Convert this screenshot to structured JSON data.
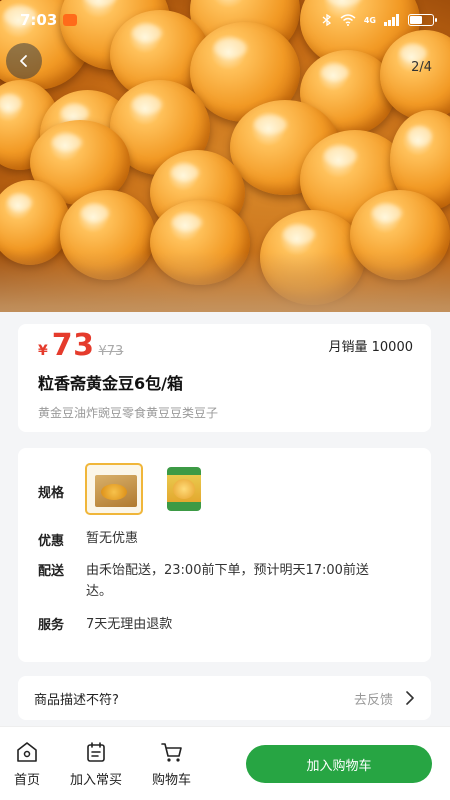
{
  "status_bar": {
    "time": "7:03",
    "network": "4G"
  },
  "gallery": {
    "pager": "2/4"
  },
  "price": {
    "currency": "¥",
    "current": "73",
    "original": "¥73"
  },
  "sales": "月销量 10000",
  "product": {
    "title": "粒香斋黄金豆6包/箱",
    "subtitle": "黄金豆油炸豌豆零食黄豆豆类豆子"
  },
  "spec": {
    "label": "规格"
  },
  "discount": {
    "label": "优惠",
    "value": "暂无优惠"
  },
  "delivery": {
    "label": "配送",
    "line1": "由禾饴配送，23:00前下单，预计明天17:00前送",
    "line2": "达。"
  },
  "service": {
    "label": "服务",
    "value": "7天无理由退款"
  },
  "feedback": {
    "label": "商品描述不符?",
    "action": "去反馈"
  },
  "bottom_bar": {
    "home": "首页",
    "add_frequent": "加入常买",
    "cart": "购物车",
    "add_to_cart": "加入购物车"
  },
  "colors": {
    "accent_green": "#27a543",
    "price_red": "#e53b2c"
  }
}
